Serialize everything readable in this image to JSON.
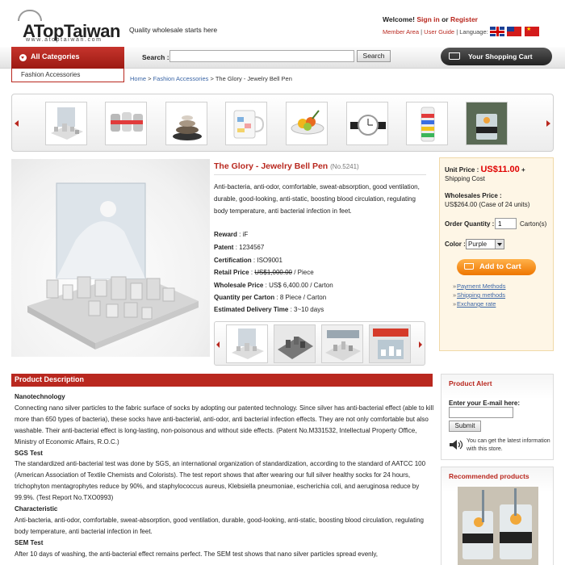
{
  "header": {
    "logo_text": "ATopTaiwan",
    "logo_url": "www.atoptaiwan.com",
    "tagline": "Quality wholesale starts here",
    "welcome_prefix": "Welcome!",
    "sign_in": "Sign in",
    "or": "or",
    "register": "Register",
    "member_area": "Member Area",
    "user_guide": "User Guide",
    "language_label": "Language:",
    "sep": "|"
  },
  "nav": {
    "all_categories": "All Categories",
    "current_category": "Fashion Accessories",
    "search_label": "Search :",
    "search_value": "",
    "search_button": "Search",
    "cart_button": "Your Shopping Cart"
  },
  "breadcrumb": {
    "home": "Home",
    "sep": ">",
    "category": "Fashion Accessories",
    "current": "The Glory - Jewelry Bell Pen"
  },
  "carousel": {
    "thumbs": [
      "jewelry-display-stand",
      "silver-cans",
      "stacked-stones",
      "mug-with-stickers",
      "fruit-dish",
      "wristwatch",
      "striped-tube",
      "glass-with-candle"
    ]
  },
  "product": {
    "title": "The Glory - Jewelry Bell Pen",
    "number": "(No.5241)",
    "description": "Anti-bacteria, anti-odor, comfortable, sweat-absorption, good ventilation, durable, good-looking, anti-static, boosting blood circulation, regulating body temperature, anti bacterial infection in feet.",
    "reward_label": "Reward",
    "reward": "iF",
    "patent_label": "Patent",
    "patent": "1234567",
    "cert_label": "Certification",
    "cert": "ISO9001",
    "retail_label": "Retail Price",
    "retail": "US$1,000.00",
    "retail_unit": "/ Piece",
    "wholesale_label": "Wholesale Price",
    "wholesale": "US$ 6,400.00 / Carton",
    "qty_carton_label": "Quantity per Carton",
    "qty_carton": "8 Piece / Carton",
    "delivery_label": "Estimated Delivery Time",
    "delivery": "3~10 days",
    "colon": ":"
  },
  "pricebox": {
    "unit_label": "Unit Price :",
    "unit_price": "US$11.00",
    "plus": "+",
    "shipping": "Shipping Cost",
    "wholesale_label": "Wholesales Price :",
    "wholesale_value": "US$264.00 (Case of 24 units)",
    "order_qty_label": "Order Quantity :",
    "order_qty": "1",
    "carton_unit": "Carton(s)",
    "color_label": "Color :",
    "color_value": "Purple",
    "add_to_cart": "Add to Cart",
    "links": [
      "Payment Methods",
      "Shipping methods",
      "Exchange rate"
    ]
  },
  "description_section": {
    "heading": "Product Description",
    "blocks": [
      {
        "title": "Nanotechnology",
        "text": "Connecting nano silver particles to the fabric surface of socks by adopting our patented technology. Since silver has anti-bacterial effect (able to kill more than 650 types of bacteria), these socks have anti-bacterial, anti-odor, anti bacterial infection effects. They are not only comfortable but also washable. Their anti-bacterial effect is long-lasting, non-poisonous and without side effects. (Patent No.M331532, Intellectual Property Office, Ministry of Economic Affairs, R.O.C.)"
      },
      {
        "title": "SGS Test",
        "text": "The standardized anti-bacterial test was done by SGS, an international organization of standardization, according to the standard of AATCC 100 (American Association of Textile Chemists and Colorists). The test report shows that after wearing our full silver healthy socks for 24 hours, trichophyton mentagrophytes reduce by 90%, and staphylococcus aureus, Klebsiella pneumoniae, escherichia coli, and aeruginosa reduce by 99.9%. (Test Report No.TXO0993)"
      },
      {
        "title": "Characteristic",
        "text": "Anti-bacteria, anti-odor, comfortable, sweat-absorption, good ventilation, durable, good-looking, anti-static, boosting blood circulation, regulating body temperature, anti bacterial infection in feet."
      },
      {
        "title": "SEM Test",
        "text": "After 10 days of washing, the anti-bacterial effect remains perfect. The SEM test shows that nano silver particles spread evenly,"
      }
    ]
  },
  "sidebar": {
    "alert_title": "Product Alert",
    "email_label": "Enter your E-mail here:",
    "email_value": "",
    "submit": "Submit",
    "alert_note": "You can get the latest information with this store.",
    "recommended_title": "Recommended products"
  },
  "colors": {
    "brand_red": "#b9281f",
    "price_red": "#e00000",
    "link_blue": "#3b66a6",
    "orange": "#ee7600"
  }
}
